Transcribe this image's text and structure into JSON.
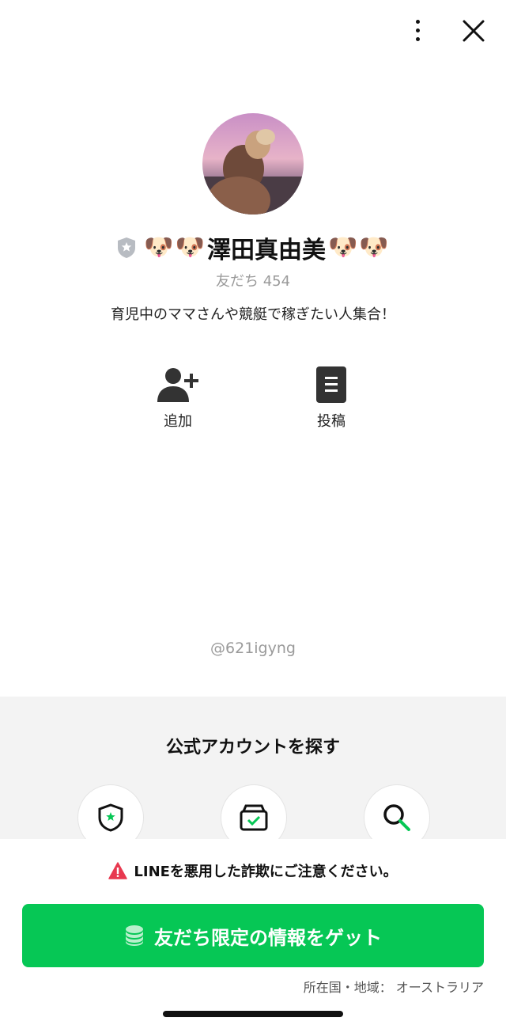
{
  "header": {
    "more_icon": "more-vertical-icon",
    "close_icon": "close-icon"
  },
  "profile": {
    "name": "澤田真由美",
    "name_emoji": "🐶",
    "friends_label": "友だち",
    "friends_count": "454",
    "status_message": "育児中のママさんや競艇で稼ぎたい人集合！",
    "line_id": "@621igyng"
  },
  "actions": [
    {
      "label": "追加",
      "icon": "add-friend-icon"
    },
    {
      "label": "投稿",
      "icon": "post-icon"
    }
  ],
  "find_section": {
    "title": "公式アカウントを探す",
    "buttons": [
      {
        "icon": "shield-star-icon"
      },
      {
        "icon": "box-check-icon"
      },
      {
        "icon": "search-icon"
      }
    ]
  },
  "warning": {
    "text": "LINEを悪用した詐欺にご注意ください。",
    "icon": "warning-triangle-icon",
    "color": "#e8384f"
  },
  "cta": {
    "label": "友だち限定の情報をゲット",
    "icon": "coins-icon",
    "color": "#06c755"
  },
  "location": {
    "label": "所在国・地域：",
    "value": "オーストラリア"
  }
}
